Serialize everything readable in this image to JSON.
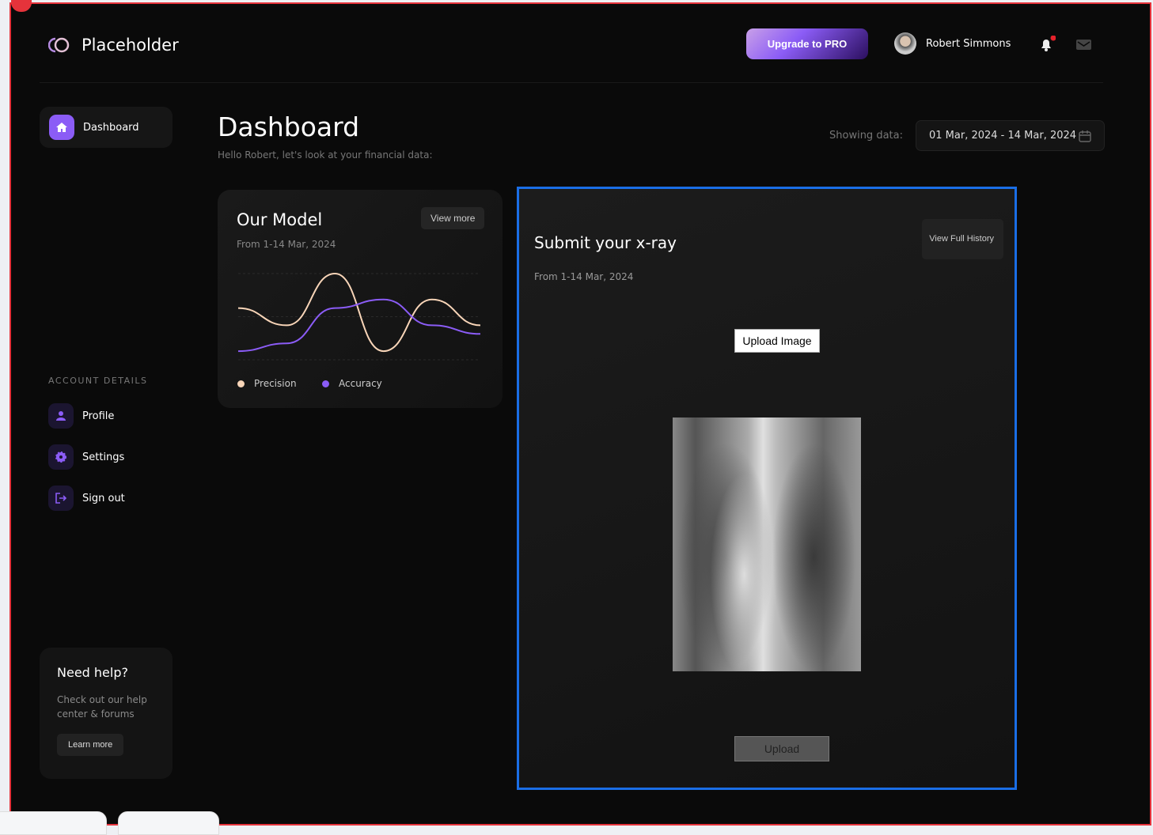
{
  "app": {
    "name": "Placeholder",
    "upgrade_label": "Upgrade to PRO",
    "user_name": "Robert Simmons"
  },
  "sidebar": {
    "items": [
      {
        "label": "Dashboard",
        "active": true
      }
    ],
    "section_title": "ACCOUNT DETAILS",
    "account_items": [
      {
        "label": "Profile"
      },
      {
        "label": "Settings"
      },
      {
        "label": "Sign out"
      }
    ]
  },
  "help": {
    "title": "Need help?",
    "text": "Check out our help center & forums",
    "button": "Learn more"
  },
  "main": {
    "title": "Dashboard",
    "subtitle": "Hello Robert, let's look at your financial data:",
    "showing_label": "Showing data:",
    "date_range": "01 Mar, 2024 - 14 Mar, 2024"
  },
  "model_card": {
    "title": "Our Model",
    "date": "From 1-14 Mar, 2024",
    "view_more": "View more"
  },
  "xray_card": {
    "title": "Submit your x-ray",
    "date": "From 1-14 Mar, 2024",
    "history_button": "View Full History",
    "upload_image": "Upload Image",
    "upload": "Upload"
  },
  "colors": {
    "accent": "#8b5cf6",
    "precision": "#f8d5b8",
    "accuracy": "#8b5cf6",
    "selection": "#1a6ee6"
  },
  "chart_data": {
    "type": "line",
    "ylim": [
      0,
      100
    ],
    "grid": true,
    "legend": "bottom-left",
    "x": [
      1,
      2,
      3,
      4,
      5,
      6
    ],
    "series": [
      {
        "name": "Precision",
        "values": [
          60,
          40,
          100,
          10,
          70,
          40
        ]
      },
      {
        "name": "Accuracy",
        "values": [
          10,
          19,
          60,
          70,
          40,
          30
        ]
      }
    ]
  }
}
